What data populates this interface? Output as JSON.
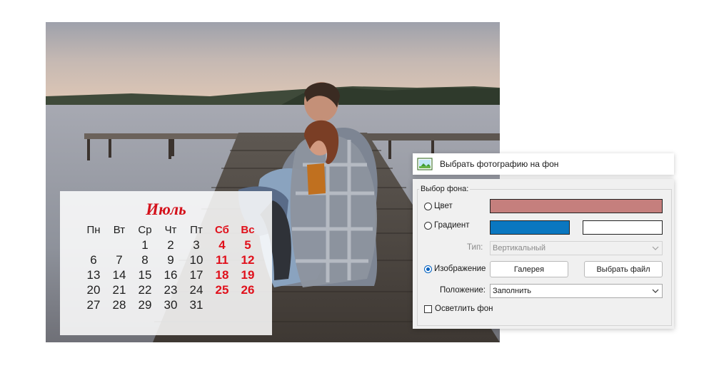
{
  "calendar": {
    "month": "Июль",
    "weekdays": [
      "Пн",
      "Вт",
      "Ср",
      "Чт",
      "Пт",
      "Сб",
      "Вс"
    ],
    "weeks": [
      [
        "",
        "",
        "1",
        "2",
        "3",
        "4",
        "5"
      ],
      [
        "6",
        "7",
        "8",
        "9",
        "10",
        "11",
        "12"
      ],
      [
        "13",
        "14",
        "15",
        "16",
        "17",
        "18",
        "19"
      ],
      [
        "20",
        "21",
        "22",
        "23",
        "24",
        "25",
        "26"
      ],
      [
        "27",
        "28",
        "29",
        "30",
        "31",
        "",
        ""
      ]
    ]
  },
  "dialog": {
    "title": "Выбрать фотографию на фон",
    "group_title": "Выбор фона:",
    "option_color": "Цвет",
    "option_gradient": "Градиент",
    "option_image": "Изображение",
    "selected_option": "image",
    "type_label": "Тип:",
    "type_value": "Вертикальный",
    "gallery_button": "Галерея",
    "choose_file_button": "Выбрать файл",
    "position_label": "Положение:",
    "position_value": "Заполнить",
    "lighten_label": "Осветлить фон",
    "lighten_checked": false,
    "colors": {
      "color_swatch": "#c57f7d",
      "gradient_start": "#0a77c0",
      "gradient_end": "#ffffff"
    }
  },
  "icons": {
    "app_icon": "image-picture-icon",
    "chevron": "chevron-down-icon"
  }
}
